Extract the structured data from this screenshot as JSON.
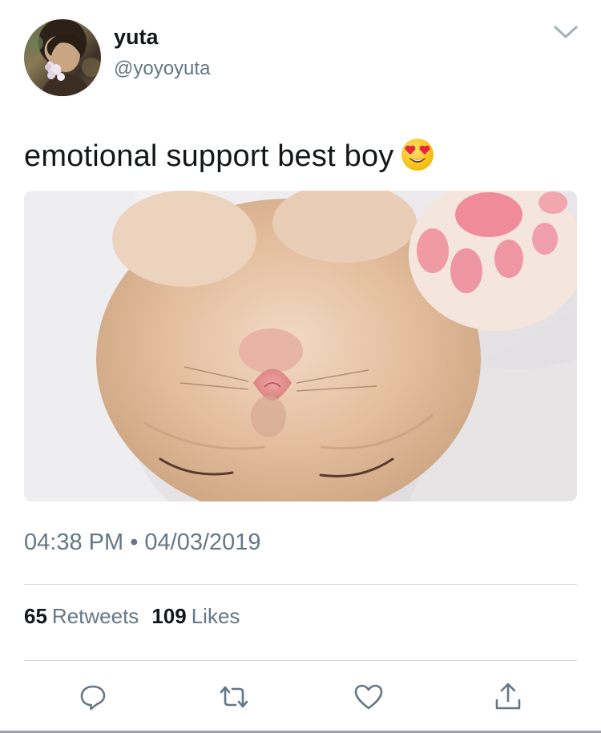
{
  "user": {
    "display_name": "yuta",
    "handle": "@yoyoyuta"
  },
  "tweet": {
    "text": "emotional support best boy",
    "emoji": "smiling-face-with-heart-eyes",
    "time": "04:38 PM",
    "separator": "•",
    "date": "04/03/2019"
  },
  "stats": {
    "retweets_count": "65",
    "retweets_label": "Retweets",
    "likes_count": "109",
    "likes_label": "Likes"
  },
  "actions": {
    "reply_icon": "reply-icon",
    "retweet_icon": "retweet-icon",
    "like_icon": "heart-icon",
    "share_icon": "share-icon"
  },
  "colors": {
    "text": "#14171a",
    "secondary": "#657786",
    "divider": "#d5d9dc"
  }
}
